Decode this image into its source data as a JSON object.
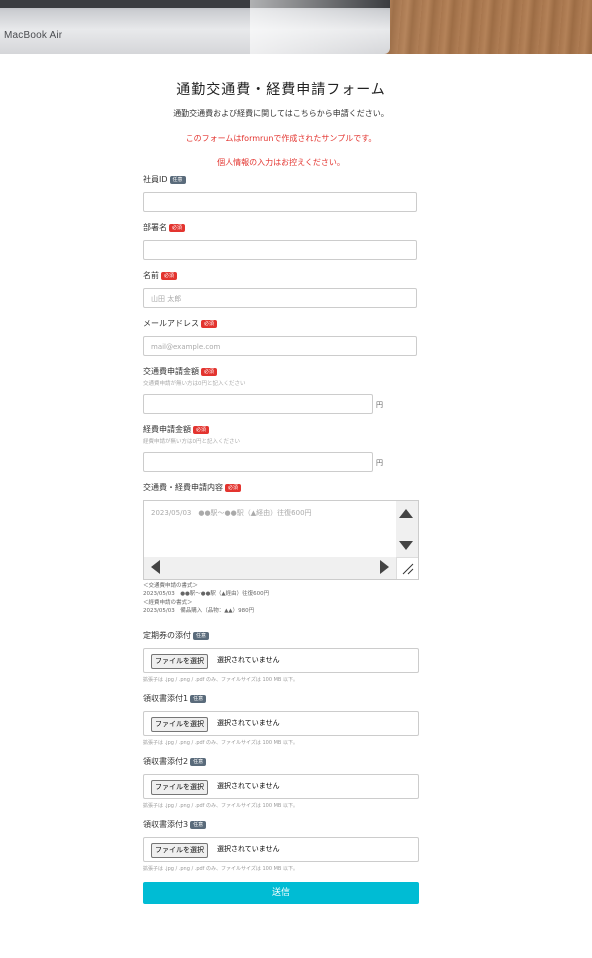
{
  "hero": {
    "brand": "MacBook Air"
  },
  "form": {
    "title": "通勤交通費・経費申請フォーム",
    "subtitle": "通勤交通費および経費に関してはこちらから申請ください。",
    "notice1": "このフォームはformrunで作成されたサンプルです。",
    "notice2": "個人情報の入力はお控えください。",
    "badges": {
      "optional": "任意",
      "required": "必須"
    },
    "fields": {
      "employee_id": {
        "label": "社員ID",
        "value": ""
      },
      "department": {
        "label": "部署名",
        "value": ""
      },
      "name": {
        "label": "名前",
        "placeholder": "山田 太郎"
      },
      "email": {
        "label": "メールアドレス",
        "placeholder": "mail@example.com"
      },
      "transport_amount": {
        "label": "交通費申請金額",
        "hint": "交通費申請が無い方は0円と記入ください",
        "unit": "円"
      },
      "expense_amount": {
        "label": "経費申請金額",
        "hint": "経費申請が無い方は0円と記入ください",
        "unit": "円"
      },
      "details": {
        "label": "交通費・経費申請内容",
        "placeholder": "2023/05/03　●●駅〜●●駅（▲経由）往復600円",
        "example_lines": [
          "＜交通費申請の書式＞",
          "2023/05/03　●●駅〜●●駅（▲経由）往復600円",
          "＜経費申請の書式＞",
          "2023/05/03　備品購入（品物：▲▲）980円"
        ]
      },
      "commuter_pass": {
        "label": "定期券の添付"
      },
      "receipt1": {
        "label": "領収書添付1"
      },
      "receipt2": {
        "label": "領収書添付2"
      },
      "receipt3": {
        "label": "領収書添付3"
      }
    },
    "file": {
      "button": "ファイルを選択",
      "status": "選択されていません",
      "hint": "拡張子は .jpg / .png / .pdf のみ、ファイルサイズは 100 MB 以下。"
    },
    "submit": "送信"
  },
  "colors": {
    "accent": "#00bcd4",
    "required": "#e3342f",
    "optional": "#5a6b7b"
  }
}
